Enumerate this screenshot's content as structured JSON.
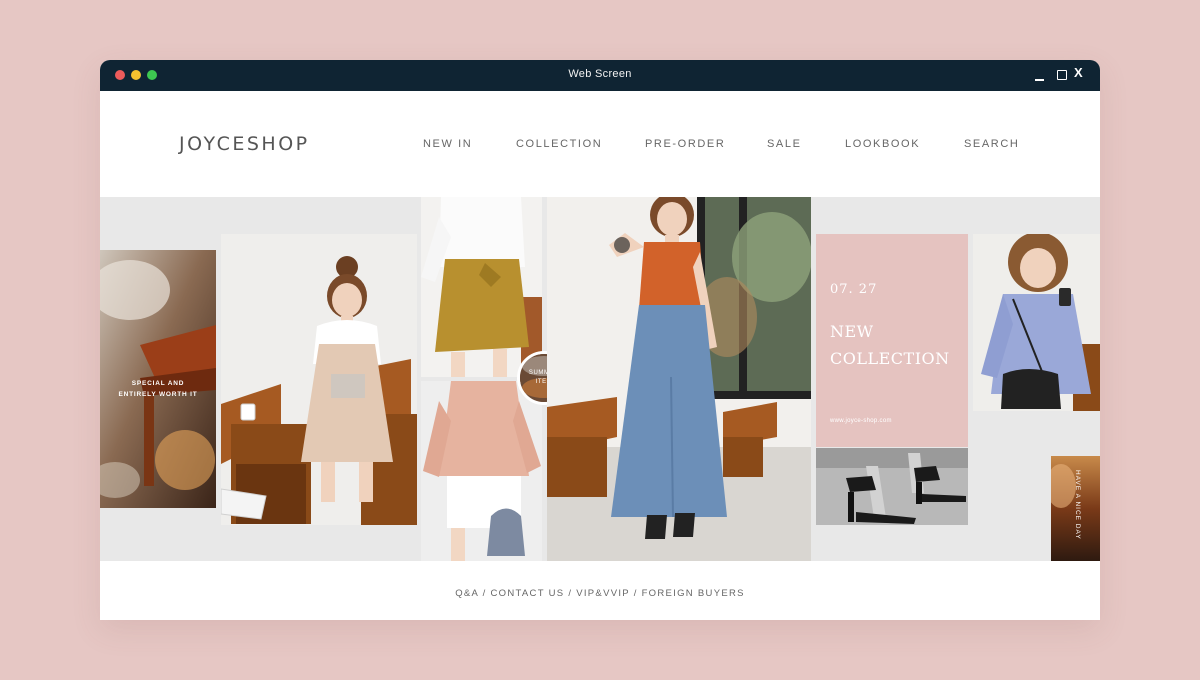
{
  "window": {
    "title": "Web Screen",
    "close_glyph": "X"
  },
  "brand": {
    "name": "JOYCESHOP"
  },
  "nav": {
    "items": [
      {
        "label": "NEW IN"
      },
      {
        "label": "COLLECTION"
      },
      {
        "label": "PRE-ORDER"
      },
      {
        "label": "SALE"
      },
      {
        "label": "LOOKBOOK"
      },
      {
        "label": "SEARCH"
      }
    ]
  },
  "hero": {
    "left_caption_line1": "SPECIAL AND",
    "left_caption_line2": "ENTIRELY WORTH IT",
    "badge_line1": "SUMMER",
    "badge_line2": "ITEM",
    "promo_date": "07. 27",
    "promo_title_line1": "NEW",
    "promo_title_line2": "COLLECTION",
    "promo_url": "www.joyce-shop.com",
    "right_vertical_caption": "HAVE A NICE DAY"
  },
  "footer": {
    "links": [
      {
        "label": "Q&A"
      },
      {
        "label": "CONTACT US"
      },
      {
        "label": "VIP&VVIP"
      },
      {
        "label": "FOREIGN BUYERS"
      }
    ],
    "separator": " / "
  },
  "colors": {
    "page_background": "#e6c7c4",
    "titlebar": "#0f2433",
    "promo_pink": "#e5c3c0",
    "hero_background": "#e8e8e8"
  }
}
